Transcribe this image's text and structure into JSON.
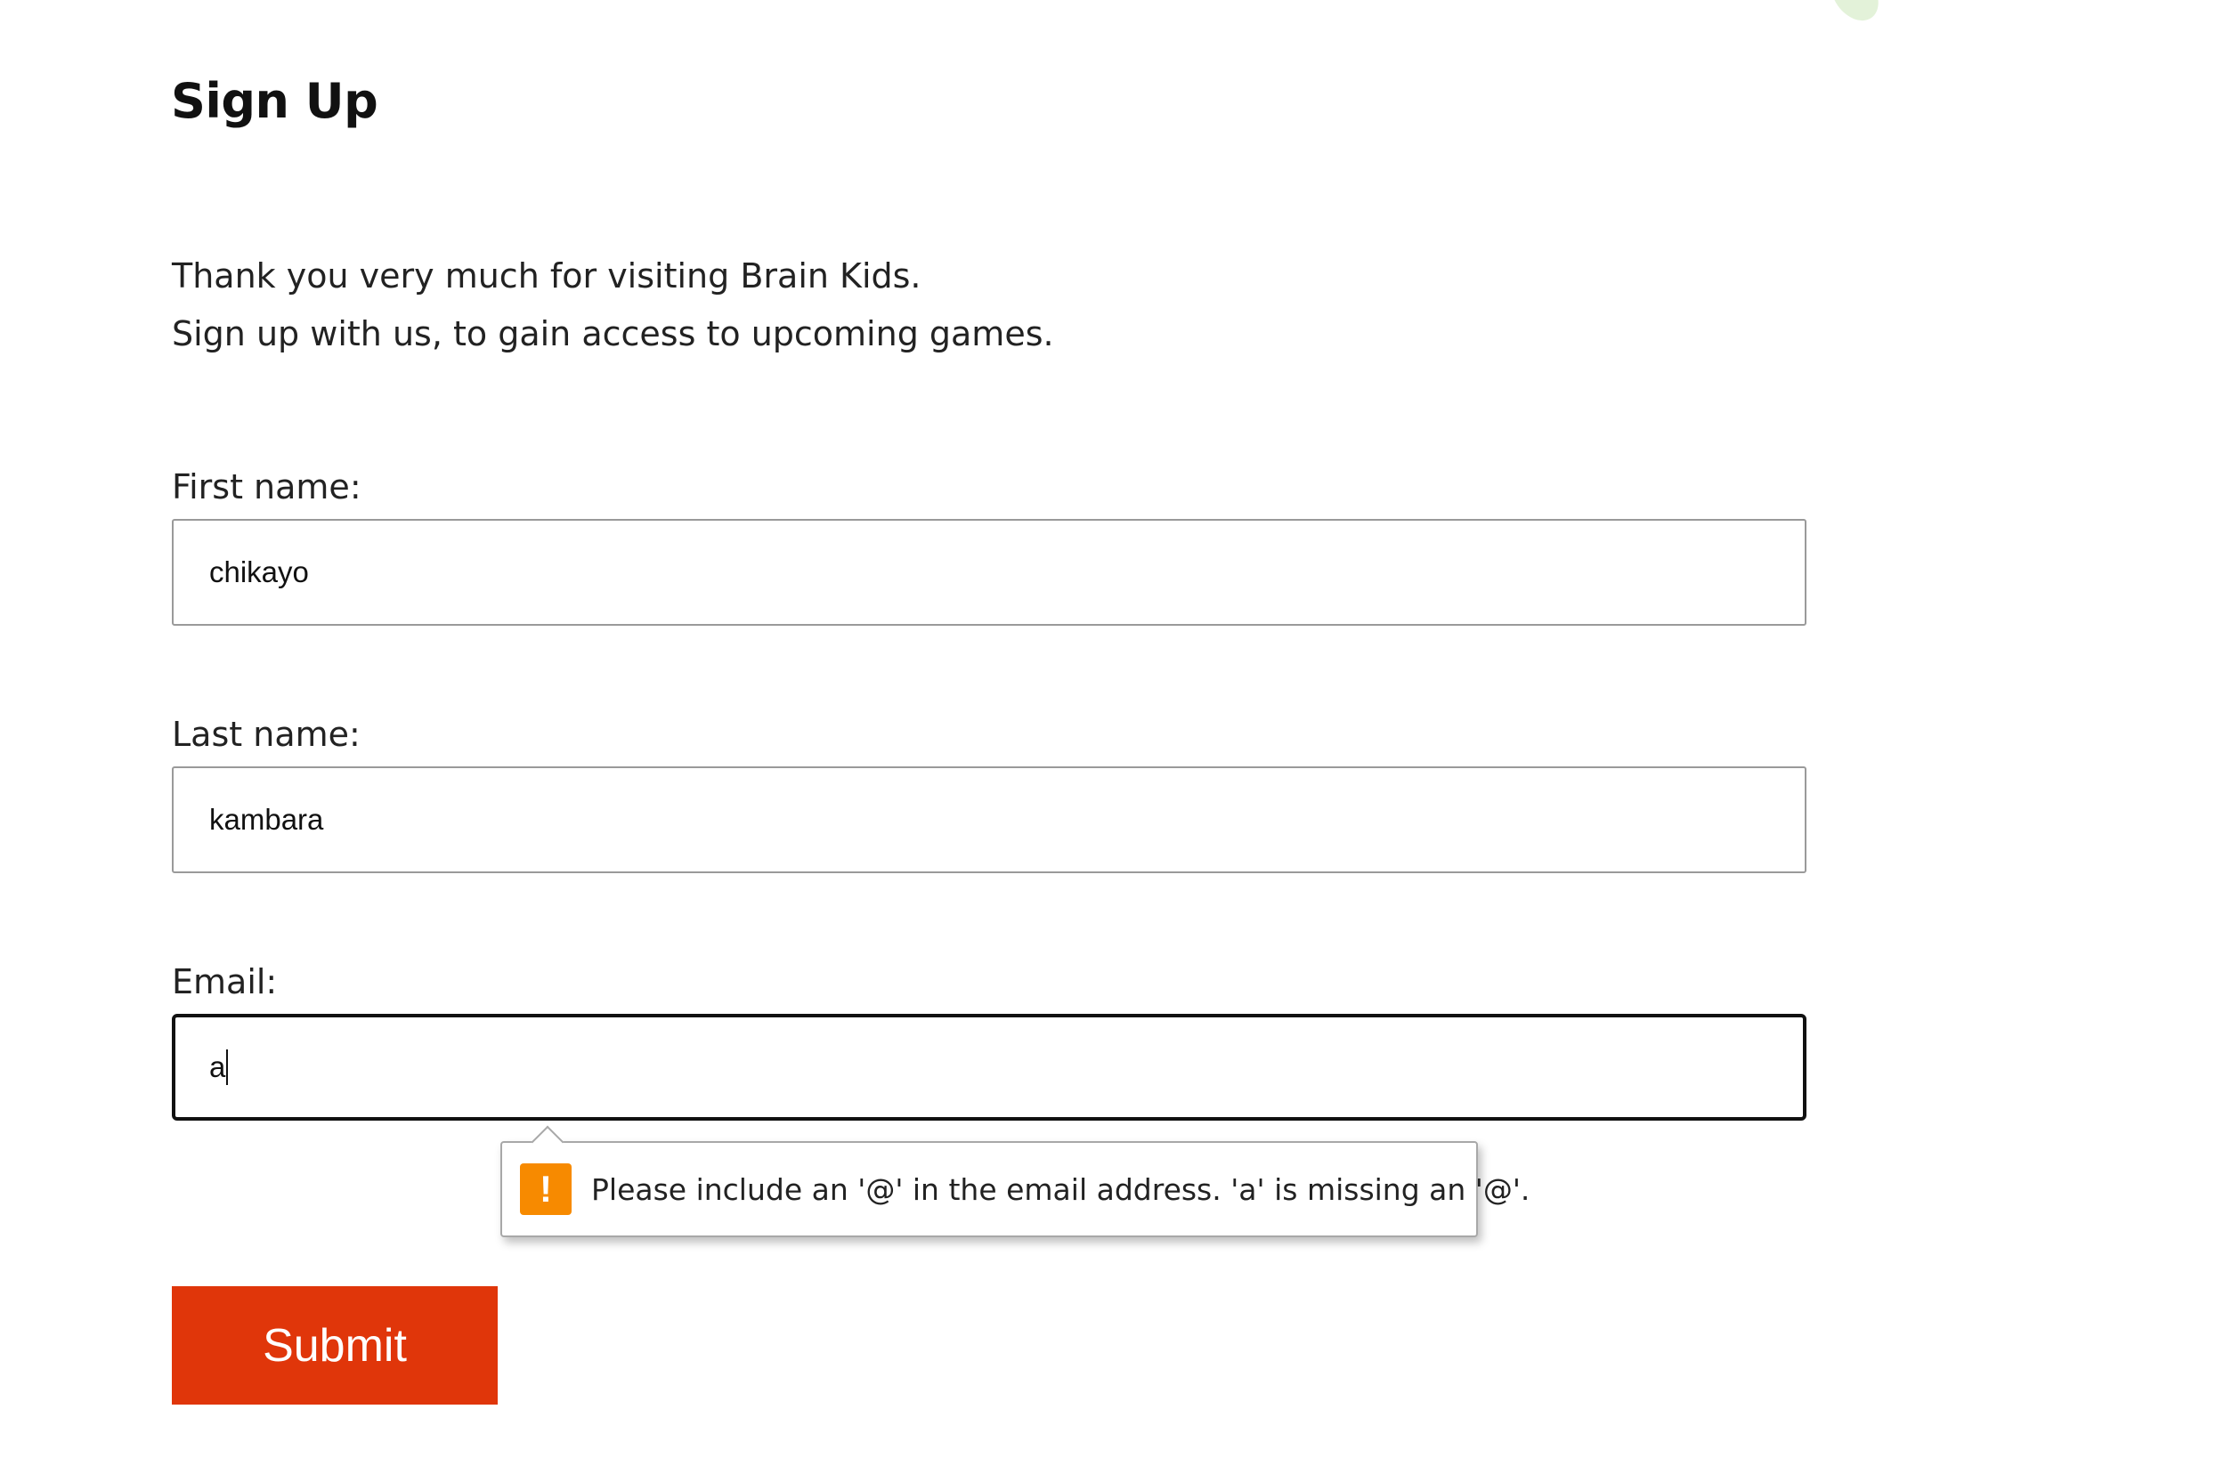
{
  "page": {
    "title": "Sign Up",
    "intro_lines": [
      "Thank you very much for visiting Brain Kids.",
      "Sign up with us, to gain access to upcoming games."
    ]
  },
  "form": {
    "first_name": {
      "label": "First name:",
      "value": "chikayo"
    },
    "last_name": {
      "label": "Last name:",
      "value": "kambara"
    },
    "email": {
      "label": "Email:",
      "value": "a"
    },
    "validation": {
      "icon": "warning-icon",
      "icon_glyph": "!",
      "icon_color": "#f78a00",
      "message": "Please include an '@' in the email address. 'a' is missing an '@'."
    },
    "submit_label": "Submit",
    "submit_color": "#e0360a"
  }
}
